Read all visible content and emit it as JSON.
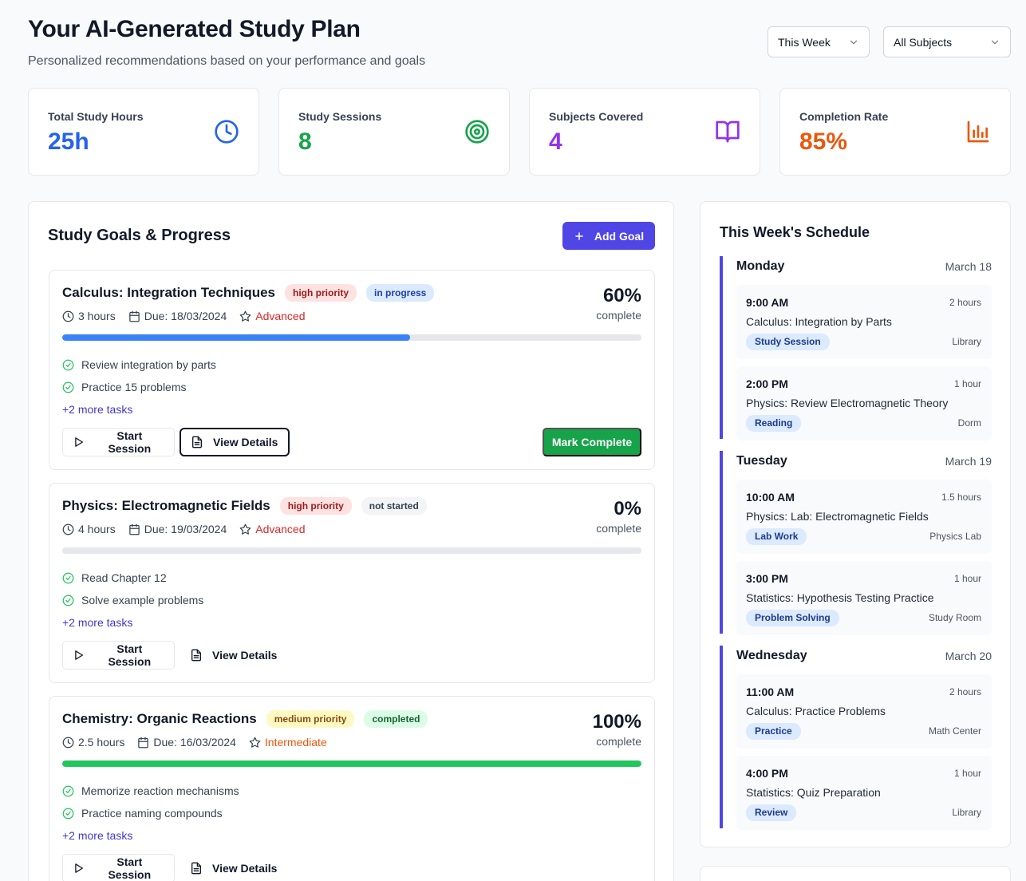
{
  "header": {
    "title": "Your AI-Generated Study Plan",
    "subtitle": "Personalized recommendations based on your performance and goals",
    "period_filter": "This Week",
    "subject_filter": "All Subjects"
  },
  "stats": [
    {
      "label": "Total Study Hours",
      "value": "25h",
      "icon": "clock-icon",
      "color": "#2563eb"
    },
    {
      "label": "Study Sessions",
      "value": "8",
      "icon": "target-icon",
      "color": "#16a34a"
    },
    {
      "label": "Subjects Covered",
      "value": "4",
      "icon": "book-open-icon",
      "color": "#9333ea"
    },
    {
      "label": "Completion Rate",
      "value": "85%",
      "icon": "bar-chart-icon",
      "color": "#ea580c"
    }
  ],
  "goals_panel": {
    "title": "Study Goals & Progress",
    "add_label": "Add Goal"
  },
  "goals": [
    {
      "title": "Calculus: Integration Techniques",
      "priority": "high priority",
      "status": "in progress",
      "hours": "3 hours",
      "due": "Due: 18/03/2024",
      "level": "Advanced",
      "percent_label": "60%",
      "progress": 0.6,
      "complete_label": "complete",
      "tasks": [
        "Review integration by parts",
        "Practice 15 problems"
      ],
      "more_tasks": "+2 more tasks",
      "start_label": "Start Session",
      "view_label": "View Details",
      "mark_label": "Mark Complete",
      "bar_color": "#3b82f6"
    },
    {
      "title": "Physics: Electromagnetic Fields",
      "priority": "high priority",
      "status": "not started",
      "hours": "4 hours",
      "due": "Due: 19/03/2024",
      "level": "Advanced",
      "percent_label": "0%",
      "progress": 0,
      "complete_label": "complete",
      "tasks": [
        "Read Chapter 12",
        "Solve example problems"
      ],
      "more_tasks": "+2 more tasks",
      "start_label": "Start Session",
      "view_label": "View Details",
      "bar_color": "#3b82f6"
    },
    {
      "title": "Chemistry: Organic Reactions",
      "priority": "medium priority",
      "status": "completed",
      "hours": "2.5 hours",
      "due": "Due: 16/03/2024",
      "level": "Intermediate",
      "percent_label": "100%",
      "progress": 1,
      "complete_label": "complete",
      "tasks": [
        "Memorize reaction mechanisms",
        "Practice naming compounds"
      ],
      "more_tasks": "+2 more tasks",
      "start_label": "Start Session",
      "view_label": "View Details",
      "bar_color": "#22c55e"
    }
  ],
  "schedule": {
    "title": "This Week's Schedule",
    "days": [
      {
        "name": "Monday",
        "date": "March 18",
        "sessions": [
          {
            "time": "9:00 AM",
            "duration": "2 hours",
            "title": "Calculus: Integration by Parts",
            "type": "Study Session",
            "location": "Library"
          },
          {
            "time": "2:00 PM",
            "duration": "1 hour",
            "title": "Physics: Review Electromagnetic Theory",
            "type": "Reading",
            "location": "Dorm"
          }
        ]
      },
      {
        "name": "Tuesday",
        "date": "March 19",
        "sessions": [
          {
            "time": "10:00 AM",
            "duration": "1.5 hours",
            "title": "Physics: Lab: Electromagnetic Fields",
            "type": "Lab Work",
            "location": "Physics Lab"
          },
          {
            "time": "3:00 PM",
            "duration": "1 hour",
            "title": "Statistics: Hypothesis Testing Practice",
            "type": "Problem Solving",
            "location": "Study Room"
          }
        ]
      },
      {
        "name": "Wednesday",
        "date": "March 20",
        "sessions": [
          {
            "time": "11:00 AM",
            "duration": "2 hours",
            "title": "Calculus: Practice Problems",
            "type": "Practice",
            "location": "Math Center"
          },
          {
            "time": "4:00 PM",
            "duration": "1 hour",
            "title": "Statistics: Quiz Preparation",
            "type": "Review",
            "location": "Library"
          }
        ]
      }
    ]
  }
}
